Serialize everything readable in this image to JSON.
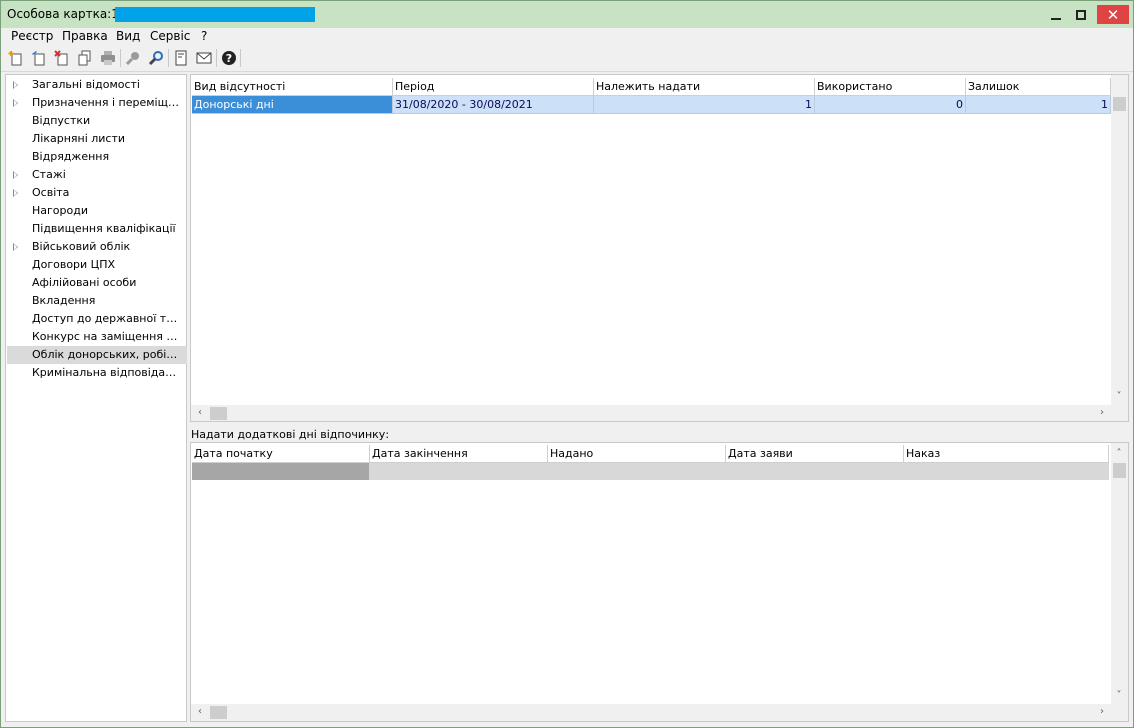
{
  "window": {
    "title": "Особова картка:129",
    "title_highlight_color": "#00a2e8",
    "titlebar_color": "#c7e3c3",
    "controls": {
      "minimize": "minimize-icon",
      "maximize": "maximize-icon",
      "close": "✕"
    }
  },
  "menu": [
    {
      "label": "Реєстр"
    },
    {
      "label": "Правка"
    },
    {
      "label": "Вид"
    },
    {
      "label": "Сервіс"
    },
    {
      "label": "?"
    }
  ],
  "toolbar": [
    {
      "icon": "new-record-icon"
    },
    {
      "icon": "edit-record-icon"
    },
    {
      "icon": "delete-record-icon"
    },
    {
      "icon": "copy-icon"
    },
    {
      "icon": "print-icon"
    },
    {
      "icon": "find-icon"
    },
    {
      "icon": "search-icon"
    },
    {
      "icon": "document-icon"
    },
    {
      "icon": "mail-icon"
    },
    {
      "icon": "help-icon"
    }
  ],
  "tree": {
    "items": [
      {
        "label": "Загальні відомості",
        "expandable": true
      },
      {
        "label": "Призначення і переміщення",
        "expandable": true
      },
      {
        "label": "Відпустки",
        "expandable": false
      },
      {
        "label": "Лікарняні листи",
        "expandable": false
      },
      {
        "label": "Відрядження",
        "expandable": false
      },
      {
        "label": "Стажі",
        "expandable": true
      },
      {
        "label": "Освіта",
        "expandable": true
      },
      {
        "label": "Нагороди",
        "expandable": false
      },
      {
        "label": "Підвищення кваліфікації",
        "expandable": false
      },
      {
        "label": "Військовий облік",
        "expandable": true
      },
      {
        "label": "Договори ЦПХ",
        "expandable": false
      },
      {
        "label": "Афілійовані особи",
        "expandable": false
      },
      {
        "label": "Вкладення",
        "expandable": false
      },
      {
        "label": "Доступ до державної таємниці",
        "expandable": false
      },
      {
        "label": "Конкурс на заміщення вакантних посад",
        "expandable": false
      },
      {
        "label": "Облік донорських, робіт в вихідні",
        "expandable": false,
        "selected": true
      },
      {
        "label": "Кримінальна відповідальність",
        "expandable": false
      }
    ]
  },
  "upper_grid": {
    "columns": [
      "Вид відсутності",
      "Період",
      "Належить надати",
      "Використано",
      "Залишок"
    ],
    "rows": [
      {
        "type": "Донорські дні",
        "period": "31/08/2020 - 30/08/2021",
        "due": "1",
        "used": "0",
        "remaining": "1"
      }
    ]
  },
  "lower_section": {
    "label": "Надати додаткові дні відпочинку:",
    "columns": [
      "Дата початку",
      "Дата закінчення",
      "Надано",
      "Дата заяви",
      "Наказ"
    ]
  },
  "scroll": {
    "left": "‹",
    "right": "›",
    "up": "˄",
    "down": "˅"
  }
}
